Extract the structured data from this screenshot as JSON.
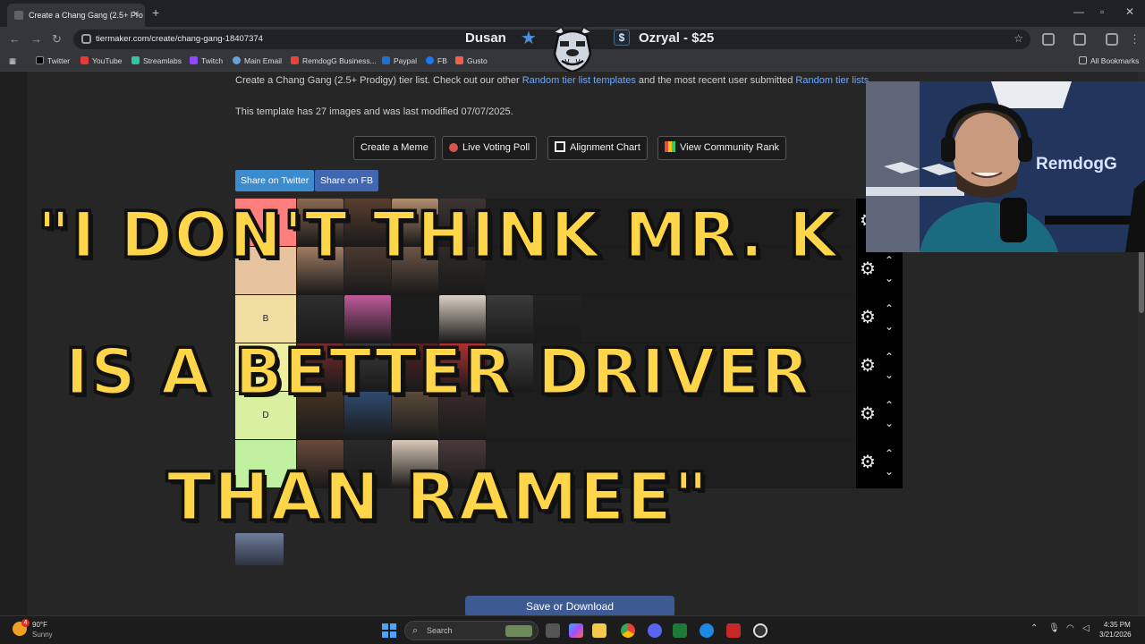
{
  "browser": {
    "tab_title": "Create a Chang Gang (2.5+ Pro",
    "url": "tiermaker.com/create/chang-gang-18407374",
    "bookmarks": [
      "Twitter",
      "YouTube",
      "Streamlabs",
      "Twitch",
      "Main Email",
      "RemdogG Business...",
      "Paypal",
      "FB",
      "Gusto"
    ],
    "all_bookmarks": "All Bookmarks"
  },
  "stream_overlay": {
    "streamer_name": "Dusan",
    "donation": "Ozryal - $25",
    "dollar_symbol": "$",
    "webcam_brand": "RemdogG"
  },
  "page": {
    "description": {
      "prefix": "Create a Chang Gang (2.5+ Prodigy) tier list. Check out our other ",
      "link1": "Random tier list templates",
      "middle": " and the most recent user submitted ",
      "link2": "Random tier lists"
    },
    "template_info": "This template has 27 images and was last modified 07/07/2025.",
    "actions": {
      "meme": "Create a Meme",
      "poll": "Live Voting Poll",
      "alignment": "Alignment Chart",
      "community": "View Community Rank"
    },
    "share": {
      "twitter": "Share on Twitter",
      "fb": "Share on FB"
    },
    "tiers": [
      {
        "label": "",
        "color": "#ff7f7f",
        "images": 4
      },
      {
        "label": "",
        "color": "#e8c3a0",
        "images": 4
      },
      {
        "label": "B",
        "color": "#f0dfa0",
        "images": 6
      },
      {
        "label": "",
        "color": "#eef0a0",
        "images": 5
      },
      {
        "label": "D",
        "color": "#d8f0a0",
        "images": 4
      },
      {
        "label": "",
        "color": "#c0f0a0",
        "images": 4
      }
    ],
    "save_button": "Save or Download"
  },
  "caption": {
    "line1": "\"I DON'T THINK MR. K",
    "line2": "IS A BETTER DRIVER",
    "line3": "THAN RAMEE\""
  },
  "taskbar": {
    "weather_temp": "90°F",
    "weather_cond": "Sunny",
    "weather_badge": "4",
    "search_placeholder": "Search",
    "time": "4:35 PM",
    "date": "3/21/2026"
  },
  "colors": {
    "caption_fill": "#ffd54a",
    "share_twitter": "#3b8ccf",
    "share_fb": "#4267b2",
    "link": "#6ea8ff"
  }
}
